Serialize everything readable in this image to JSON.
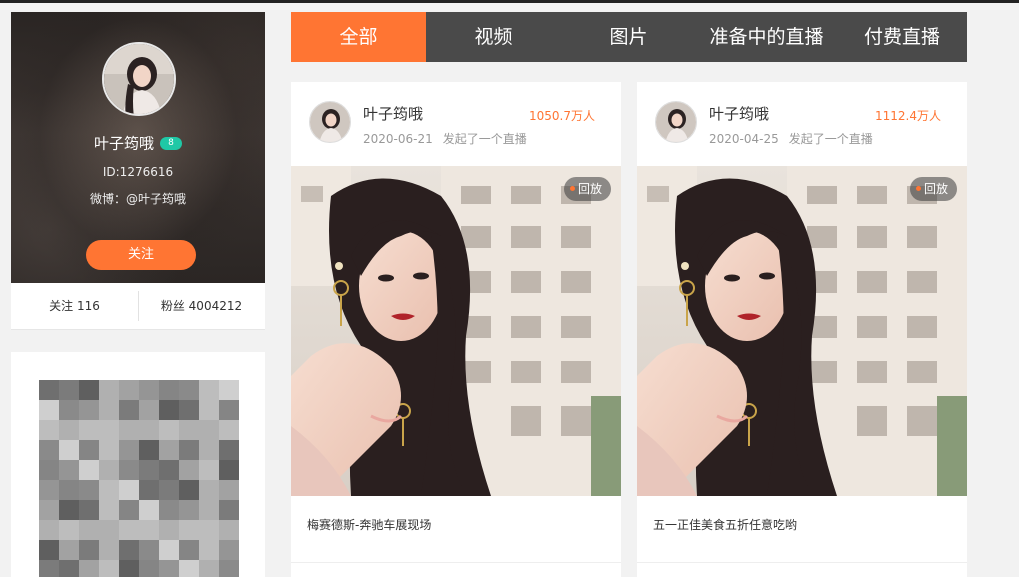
{
  "profile": {
    "name": "叶子筠哦",
    "level": "8",
    "id": "ID:1276616",
    "weibo": "微博：@叶子筠哦",
    "follow_button": "关注",
    "following_label": "关注 116",
    "fans_label": "粉丝 4004212"
  },
  "tabs": [
    {
      "label": "全部",
      "active": true
    },
    {
      "label": "视频",
      "active": false
    },
    {
      "label": "图片",
      "active": false
    },
    {
      "label": "准备中的直播",
      "active": false
    },
    {
      "label": "付费直播",
      "active": false
    }
  ],
  "cards": [
    {
      "author": "叶子筠哦",
      "views": "1050.7万人",
      "date": "2020-06-21",
      "action": "发起了一个直播",
      "badge": "回放",
      "title": "梅赛德斯-奔驰车展现场"
    },
    {
      "author": "叶子筠哦",
      "views": "1112.4万人",
      "date": "2020-04-25",
      "action": "发起了一个直播",
      "badge": "回放",
      "title": "五一正佳美食五折任意吃哟"
    }
  ],
  "colors": {
    "accent": "#ff7533",
    "tab_bar": "#4a4a4a",
    "level_badge": "#1fc8a6"
  },
  "icons": [
    "avatar-image",
    "qr-code-pixelated",
    "live-thumbnail-image",
    "replay-dot-icon"
  ]
}
